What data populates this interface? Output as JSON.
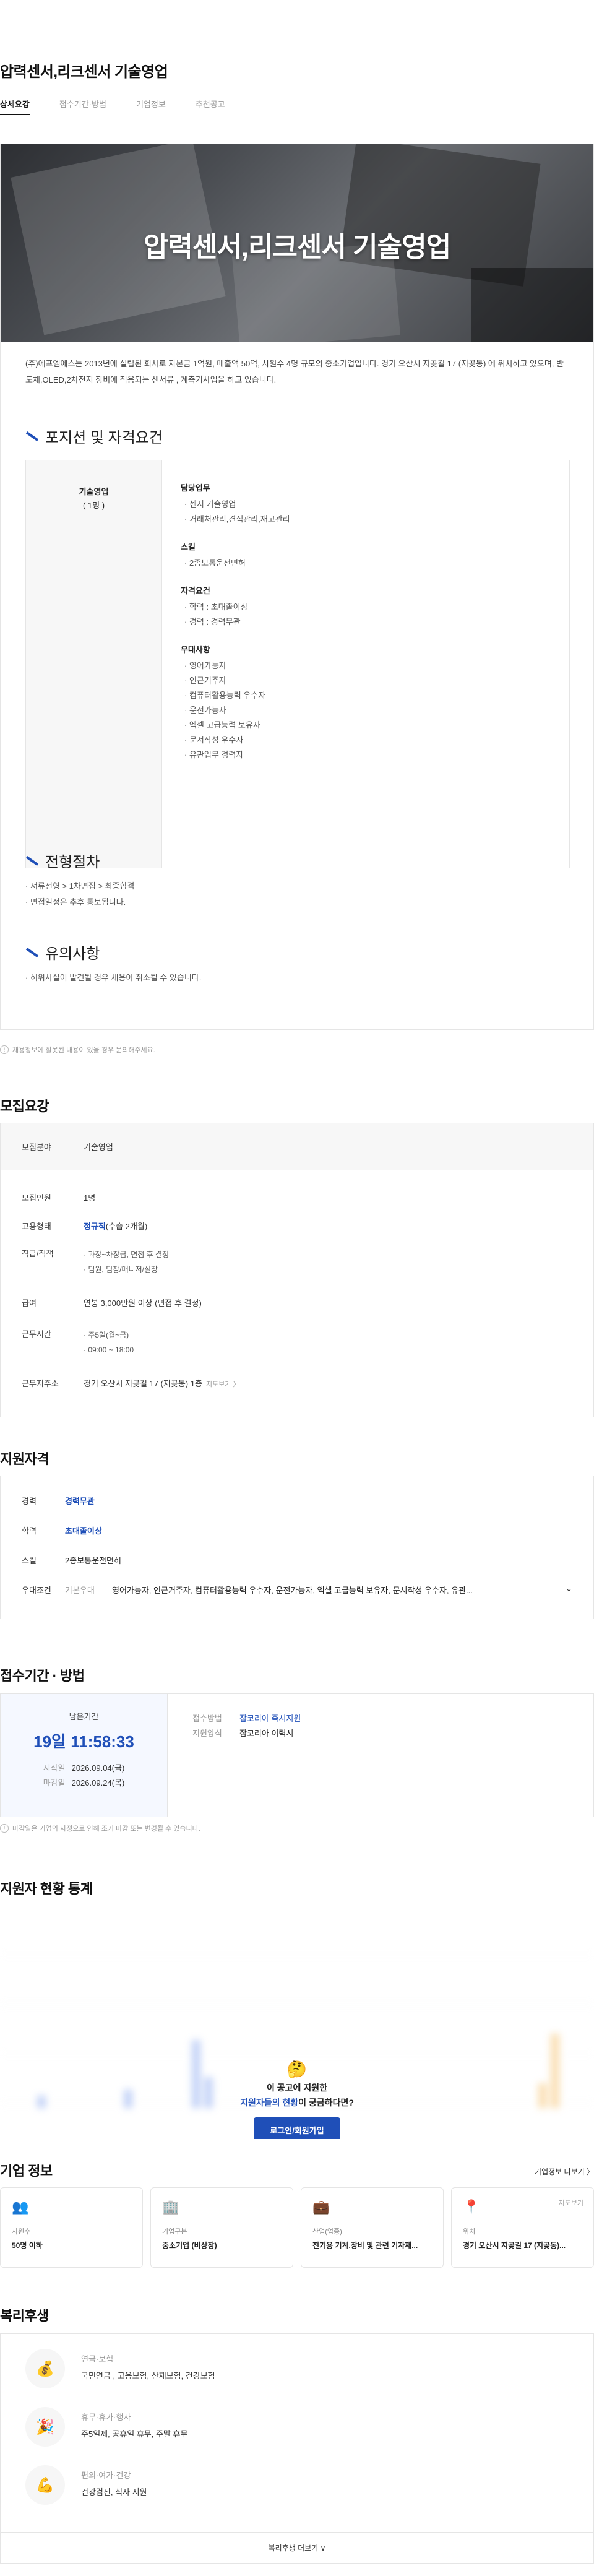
{
  "job": {
    "title": "압력센서,리크센서 기술영업"
  },
  "tabs": [
    "상세요강",
    "접수기간·방법",
    "기업정보",
    "추천공고"
  ],
  "detail": {
    "hero_title": "압력센서,리크센서 기술영업",
    "intro": "(주)에프엠에스는 2013년에 설립된 회사로 자본금 1억원, 매출액 50억, 사원수 4명 규모의 중소기업입니다. 경기 오산시 지곶길 17 (지곶동) 에 위치하고 있으며, 반도체,OLED,2차전지 장비에 적용되는 센서류 , 계측기사업을 하고 있습니다.",
    "section_position": "포지션 및 자격요건",
    "position_name": "기술영업",
    "position_count": "( 1명 )",
    "groups": [
      {
        "title": "담당업무",
        "items": [
          "· 센서 기술영업",
          "· 거래처관리,견적관리,재고관리"
        ]
      },
      {
        "title": "스킬",
        "items": [
          "· 2종보통운전면허"
        ]
      },
      {
        "title": "자격요건",
        "items": [
          "· 학력 : 초대졸이상",
          "· 경력 : 경력무관"
        ]
      },
      {
        "title": "우대사항",
        "items": [
          "· 영어가능자",
          "· 인근거주자",
          "· 컴퓨터활용능력 우수자",
          "· 운전가능자",
          "· 엑셀 고급능력 보유자",
          "· 문서작성 우수자",
          "· 유관업무 경력자"
        ]
      }
    ],
    "section_process": "전형절차",
    "process_items": [
      "· 서류전형 > 1차면접 > 최종합격",
      "· 면접일정은 추후 통보됩니다."
    ],
    "section_caution": "유의사항",
    "caution_items": [
      "· 허위사실이 발견될 경우 채용이 취소될 수 있습니다."
    ],
    "note": "채용정보에 잘못된 내용이 있을 경우 문의해주세요."
  },
  "recruit": {
    "title": "모집요강",
    "field_key": "모집분야",
    "field_val": "기술영업",
    "count_key": "모집인원",
    "count_val": "1명",
    "type_key": "고용형태",
    "type_val_bold": "정규직",
    "type_val_extra": "(수습 2개월)",
    "rank_key": "직급/직책",
    "rank_items": [
      "· 과장~차장급, 면접 후 결정",
      "· 팀원, 팀장/매니저/실장"
    ],
    "salary_key": "급여",
    "salary_val": "연봉 3,000만원 이상 (면접 후 결정)",
    "hours_key": "근무시간",
    "hours_items": [
      "· 주5일(월~금)",
      "· 09:00 ~ 18:00"
    ],
    "loc_key": "근무지주소",
    "loc_val": "경기 오산시 지곶길 17 (지곶동) 1층",
    "loc_link": "지도보기 〉"
  },
  "qual": {
    "title": "지원자격",
    "career_key": "경력",
    "career_val": "경력무관",
    "edu_key": "학력",
    "edu_val": "초대졸이상",
    "skill_key": "스킬",
    "skill_val": "2종보통운전면허",
    "pref_key": "우대조건",
    "pref_label": "기본우대",
    "pref_val": "영어가능자, 인근거주자, 컴퓨터활용능력 우수자, 운전가능자, 엑셀 고급능력 보유자, 문서작성 우수자, 유관..."
  },
  "period": {
    "title": "접수기간 · 방법",
    "remain_label": "남은기간",
    "remain_val": "19일 11:58:33",
    "start_key": "시작일",
    "start_val": "2026.09.04(금)",
    "end_key": "마감일",
    "end_val": "2026.09.24(목)",
    "method_key": "접수방법",
    "method_val": "잡코리아 즉시지원",
    "form_key": "지원양식",
    "form_val": "잡코리아 이력서",
    "note": "마감일은 기업의 사정으로 인해 조기 마감 또는 변경될 수 있습니다."
  },
  "stats": {
    "title": "지원자 현황 통계",
    "question1": "이 공고에 지원한",
    "question2_blue": "지원자들의 현황",
    "question2_rest": "이 궁금하다면?",
    "button": "로그인/회원가입"
  },
  "company": {
    "title": "기업 정보",
    "more": "기업정보 더보기 〉",
    "cards": [
      {
        "icon": "people-icon",
        "glyph": "👥",
        "key": "사원수",
        "val": "50명 이하"
      },
      {
        "icon": "building-icon",
        "glyph": "🏢",
        "key": "기업구분",
        "val": "중소기업 (비상장)"
      },
      {
        "icon": "briefcase-icon",
        "glyph": "💼",
        "key": "산업(업종)",
        "val": "전기용 기계.장비 및 관련 기자재..."
      },
      {
        "icon": "location-pin-icon",
        "glyph": "📍",
        "key": "위치",
        "val": "경기 오산시 지곶길 17 (지곶동)...",
        "map": "지도보기"
      }
    ]
  },
  "welfare": {
    "title": "복리후생",
    "items": [
      {
        "icon": "piggy-bank-icon",
        "glyph": "💰",
        "key": "연금·보험",
        "val": "국민연금 , 고용보험, 산재보험, 건강보험"
      },
      {
        "icon": "party-popper-icon",
        "glyph": "🎉",
        "key": "휴무·휴가·행사",
        "val": "주5일제, 공휴일 휴무, 주말 휴무"
      },
      {
        "icon": "muscle-icon",
        "glyph": "💪",
        "key": "편의·여가·건강",
        "val": "건강검진, 식사 지원"
      }
    ],
    "more": "복리후생 더보기 ∨"
  }
}
